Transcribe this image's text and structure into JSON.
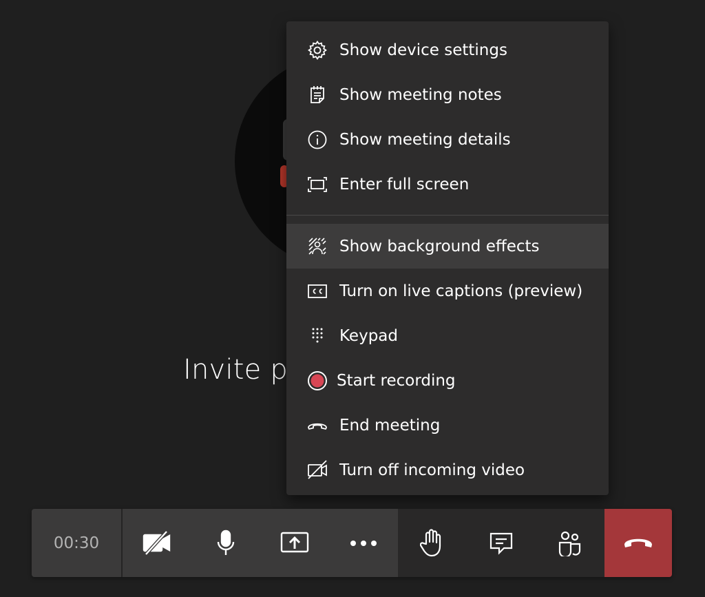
{
  "stage": {
    "invite_text": "Invite p"
  },
  "menu": {
    "items": [
      {
        "label": "Show device settings",
        "icon": "gear-icon"
      },
      {
        "label": "Show meeting notes",
        "icon": "notes-icon"
      },
      {
        "label": "Show meeting details",
        "icon": "info-icon"
      },
      {
        "label": "Enter full screen",
        "icon": "fullscreen-icon"
      },
      {
        "label": "Show background effects",
        "icon": "background-effects-icon"
      },
      {
        "label": "Turn on live captions (preview)",
        "icon": "captions-icon"
      },
      {
        "label": "Keypad",
        "icon": "keypad-icon"
      },
      {
        "label": "Start recording",
        "icon": "record-icon"
      },
      {
        "label": "End meeting",
        "icon": "end-meeting-icon"
      },
      {
        "label": "Turn off incoming video",
        "icon": "video-off-icon"
      }
    ]
  },
  "toolbar": {
    "timer": "00:30",
    "buttons": [
      {
        "name": "camera-off-button",
        "icon": "camera-off-icon"
      },
      {
        "name": "microphone-button",
        "icon": "microphone-icon"
      },
      {
        "name": "share-screen-button",
        "icon": "share-screen-icon"
      },
      {
        "name": "more-actions-button",
        "icon": "more-icon"
      },
      {
        "name": "raise-hand-button",
        "icon": "hand-icon"
      },
      {
        "name": "chat-button",
        "icon": "chat-icon"
      },
      {
        "name": "participants-button",
        "icon": "participants-icon"
      },
      {
        "name": "hang-up-button",
        "icon": "hang-up-icon"
      }
    ]
  },
  "colors": {
    "background": "#1f1f1f",
    "menu_background": "#2d2c2c",
    "menu_hover": "#3d3c3c",
    "toolbar_light": "#3b3a3a",
    "toolbar_dark": "#292828",
    "hang_up": "#a4373a",
    "record_dot": "#d74654"
  }
}
